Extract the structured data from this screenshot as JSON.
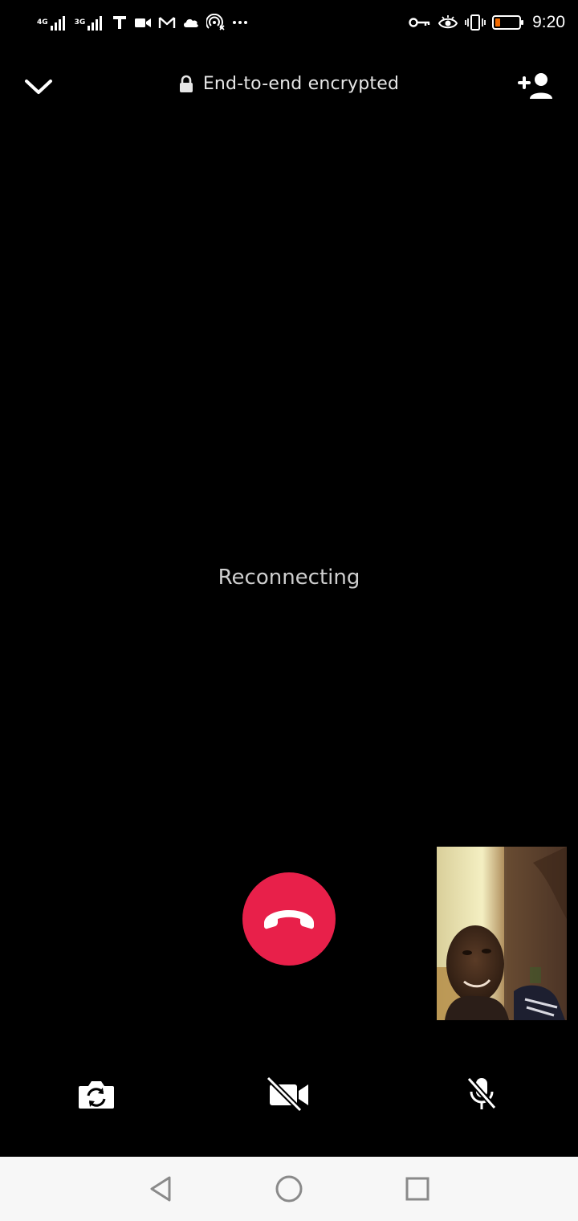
{
  "status_bar": {
    "network_1": "4G",
    "network_2": "3G",
    "time": "9:20",
    "battery_color": "#f26a00",
    "icons": [
      "signal-icon",
      "signal-icon",
      "text-app-icon",
      "video-icon",
      "gmail-icon",
      "cloud-icon",
      "hotspot-icon",
      "more-notifications-icon",
      "key-icon",
      "eye-icon",
      "vibrate-icon",
      "battery-icon"
    ]
  },
  "top_bar": {
    "encryption_label": "End-to-end encrypted",
    "icons": [
      "chevron-down-icon",
      "lock-icon",
      "add-person-icon"
    ]
  },
  "call": {
    "status": "Reconnecting",
    "end_call_color": "#e8204a"
  },
  "controls": {
    "icons": [
      "switch-camera-icon",
      "video-off-icon",
      "mic-off-icon"
    ]
  },
  "nav_bar": {
    "icons": [
      "back-icon",
      "home-icon",
      "recents-icon"
    ]
  }
}
